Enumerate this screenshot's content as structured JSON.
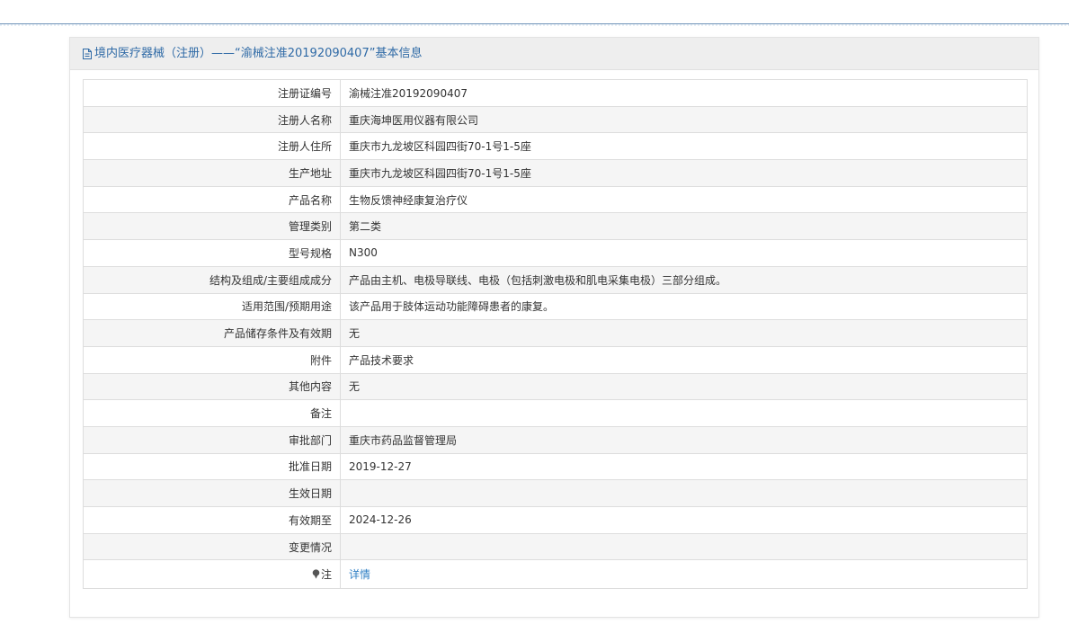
{
  "header": {
    "title": "境内医疗器械（注册）——“渝械注准20192090407”基本信息",
    "icon": "document-icon"
  },
  "rows": [
    {
      "label": "注册证编号",
      "value": "渝械注准20192090407"
    },
    {
      "label": "注册人名称",
      "value": "重庆海坤医用仪器有限公司"
    },
    {
      "label": "注册人住所",
      "value": "重庆市九龙坡区科园四街70-1号1-5座"
    },
    {
      "label": "生产地址",
      "value": "重庆市九龙坡区科园四街70-1号1-5座"
    },
    {
      "label": "产品名称",
      "value": "生物反馈神经康复治疗仪"
    },
    {
      "label": "管理类别",
      "value": "第二类"
    },
    {
      "label": "型号规格",
      "value": "N300"
    },
    {
      "label": "结构及组成/主要组成成分",
      "value": "产品由主机、电极导联线、电极（包括刺激电极和肌电采集电极）三部分组成。"
    },
    {
      "label": "适用范围/预期用途",
      "value": "该产品用于肢体运动功能障碍患者的康复。"
    },
    {
      "label": "产品储存条件及有效期",
      "value": "无"
    },
    {
      "label": "附件",
      "value": "产品技术要求"
    },
    {
      "label": "其他内容",
      "value": "无"
    },
    {
      "label": "备注",
      "value": ""
    },
    {
      "label": "审批部门",
      "value": "重庆市药品监督管理局"
    },
    {
      "label": "批准日期",
      "value": "2019-12-27"
    },
    {
      "label": "生效日期",
      "value": ""
    },
    {
      "label": "有效期至",
      "value": "2024-12-26"
    },
    {
      "label": "变更情况",
      "value": ""
    }
  ],
  "note": {
    "label": "注",
    "icon": "pin-icon",
    "link_text": "详情"
  },
  "colors": {
    "title": "#2f6aa6",
    "link": "#2f7fc4",
    "border": "#dddddd",
    "stripe": "#f5f5f5",
    "header_bg": "#eeeeee"
  }
}
